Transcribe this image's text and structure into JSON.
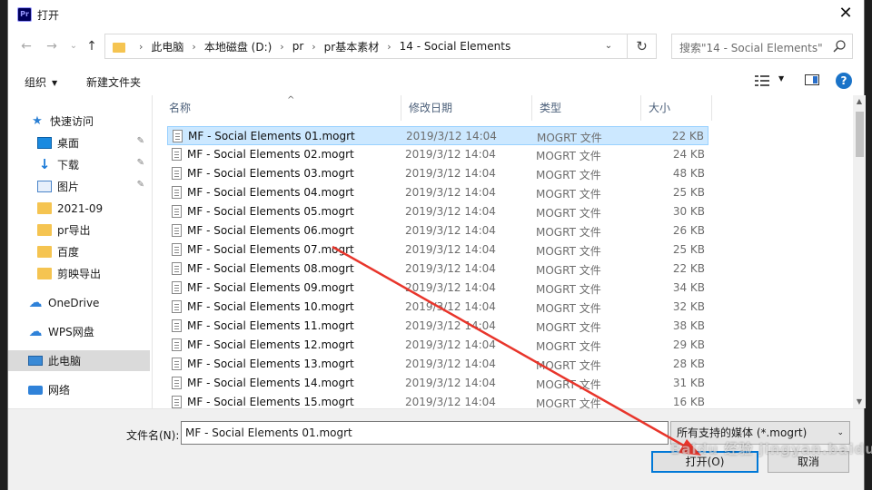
{
  "window": {
    "app_icon_text": "Pr",
    "title": "打开",
    "close_glyph": "✕"
  },
  "nav_buttons": {
    "back": "←",
    "forward": "→",
    "recent": "⌄",
    "up": "↑"
  },
  "address": {
    "crumbs": [
      "此电脑",
      "本地磁盘 (D:)",
      "pr",
      "pr基本素材",
      "14 - Social Elements"
    ],
    "separator": "›",
    "dropdown_glyph": "⌄",
    "refresh_glyph": "↻"
  },
  "search": {
    "placeholder": "搜索\"14 - Social Elements\""
  },
  "toolbar": {
    "organize_label": "组织",
    "organize_caret": "▼",
    "new_folder_label": "新建文件夹",
    "view_caret": "▼",
    "help_glyph": "?"
  },
  "nav": {
    "quick_access": "快速访问",
    "items": [
      {
        "label": "桌面",
        "pinned": true
      },
      {
        "label": "下载",
        "pinned": true
      },
      {
        "label": "图片",
        "pinned": true
      },
      {
        "label": "2021-09",
        "pinned": false
      },
      {
        "label": "pr导出",
        "pinned": false
      },
      {
        "label": "百度",
        "pinned": false
      },
      {
        "label": "剪映导出",
        "pinned": false
      }
    ],
    "onedrive": "OneDrive",
    "wps": "WPS网盘",
    "this_pc": "此电脑",
    "network": "网络",
    "pin_glyph": "📌"
  },
  "columns": {
    "name": "名称",
    "date": "修改日期",
    "type": "类型",
    "size": "大小",
    "sort_glyph": "^"
  },
  "files": [
    {
      "name": "MF - Social Elements 01.mogrt",
      "date": "2019/3/12 14:04",
      "type": "MOGRT 文件",
      "size": "22 KB"
    },
    {
      "name": "MF - Social Elements 02.mogrt",
      "date": "2019/3/12 14:04",
      "type": "MOGRT 文件",
      "size": "24 KB"
    },
    {
      "name": "MF - Social Elements 03.mogrt",
      "date": "2019/3/12 14:04",
      "type": "MOGRT 文件",
      "size": "48 KB"
    },
    {
      "name": "MF - Social Elements 04.mogrt",
      "date": "2019/3/12 14:04",
      "type": "MOGRT 文件",
      "size": "25 KB"
    },
    {
      "name": "MF - Social Elements 05.mogrt",
      "date": "2019/3/12 14:04",
      "type": "MOGRT 文件",
      "size": "30 KB"
    },
    {
      "name": "MF - Social Elements 06.mogrt",
      "date": "2019/3/12 14:04",
      "type": "MOGRT 文件",
      "size": "26 KB"
    },
    {
      "name": "MF - Social Elements 07.mogrt",
      "date": "2019/3/12 14:04",
      "type": "MOGRT 文件",
      "size": "25 KB"
    },
    {
      "name": "MF - Social Elements 08.mogrt",
      "date": "2019/3/12 14:04",
      "type": "MOGRT 文件",
      "size": "22 KB"
    },
    {
      "name": "MF - Social Elements 09.mogrt",
      "date": "2019/3/12 14:04",
      "type": "MOGRT 文件",
      "size": "34 KB"
    },
    {
      "name": "MF - Social Elements 10.mogrt",
      "date": "2019/3/12 14:04",
      "type": "MOGRT 文件",
      "size": "32 KB"
    },
    {
      "name": "MF - Social Elements 11.mogrt",
      "date": "2019/3/12 14:04",
      "type": "MOGRT 文件",
      "size": "38 KB"
    },
    {
      "name": "MF - Social Elements 12.mogrt",
      "date": "2019/3/12 14:04",
      "type": "MOGRT 文件",
      "size": "29 KB"
    },
    {
      "name": "MF - Social Elements 13.mogrt",
      "date": "2019/3/12 14:04",
      "type": "MOGRT 文件",
      "size": "28 KB"
    },
    {
      "name": "MF - Social Elements 14.mogrt",
      "date": "2019/3/12 14:04",
      "type": "MOGRT 文件",
      "size": "31 KB"
    },
    {
      "name": "MF - Social Elements 15.mogrt",
      "date": "2019/3/12 14:04",
      "type": "MOGRT 文件",
      "size": "16 KB"
    }
  ],
  "scrollbar": {
    "up_glyph": "▲",
    "down_glyph": "▼"
  },
  "bottom": {
    "filename_label": "文件名(N):",
    "filename_value": "MF - Social Elements 01.mogrt",
    "filter_value": "所有支持的媒体 (*.mogrt)",
    "filter_caret": "⌄",
    "open_label": "打开(O)",
    "cancel_label": "取消"
  },
  "watermark": "Baidu 经验 jingyan.baidu.com",
  "colors": {
    "accent": "#0078d7",
    "selection": "#cce8ff",
    "annotation_arrow": "#e8352b"
  }
}
